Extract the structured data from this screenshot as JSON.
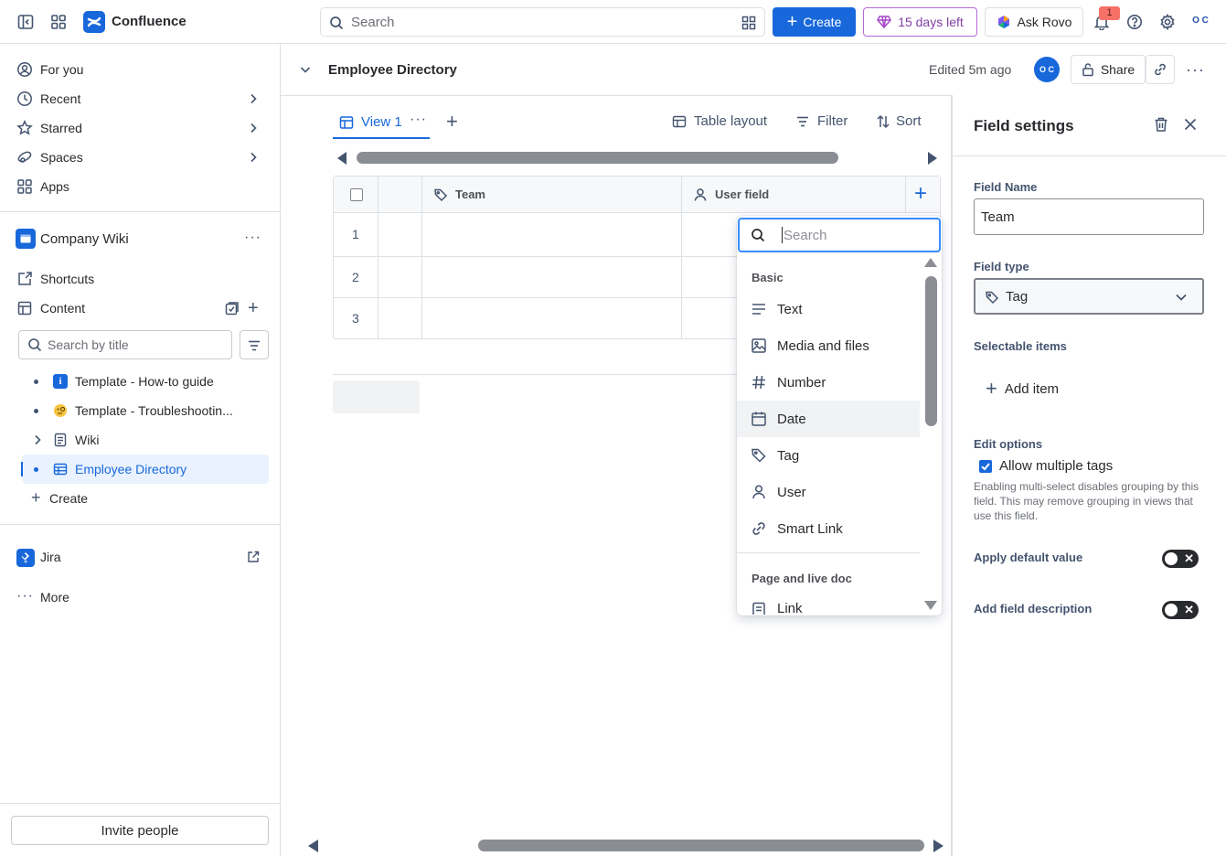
{
  "topbar": {
    "app_name": "Confluence",
    "search_placeholder": "Search",
    "create_label": "Create",
    "trial_label": "15 days left",
    "rovo_label": "Ask Rovo",
    "notification_count": "1",
    "avatar_initials": "O C",
    "brand_color": "#1868db"
  },
  "sidebar": {
    "nav": [
      {
        "label": "For you",
        "icon": "user-circle-icon"
      },
      {
        "label": "Recent",
        "icon": "clock-icon"
      },
      {
        "label": "Starred",
        "icon": "star-icon"
      },
      {
        "label": "Spaces",
        "icon": "spaces-icon"
      },
      {
        "label": "Apps",
        "icon": "apps-icon"
      }
    ],
    "space_name": "Company Wiki",
    "shortcuts_label": "Shortcuts",
    "content_label": "Content",
    "search_placeholder": "Search by title",
    "tree": [
      {
        "label": "Template - How-to guide",
        "icon": "info-icon"
      },
      {
        "label": "Template - Troubleshootin...",
        "icon": "emoji-icon"
      },
      {
        "label": "Wiki",
        "icon": "page-icon"
      },
      {
        "label": "Employee Directory",
        "icon": "database-icon",
        "selected": true
      }
    ],
    "create_label": "Create",
    "jira_label": "Jira",
    "more_label": "More",
    "invite_label": "Invite people"
  },
  "page": {
    "title": "Employee Directory",
    "edited": "Edited 5m ago",
    "owner_initials": "O C",
    "share_label": "Share"
  },
  "database": {
    "view_tab": "View 1",
    "layout_label": "Table layout",
    "filter_label": "Filter",
    "sort_label": "Sort",
    "columns": [
      "Team",
      "User field"
    ],
    "rows": [
      "1",
      "2",
      "3"
    ]
  },
  "type_menu": {
    "search_placeholder": "Search",
    "section_basic": "Basic",
    "items": [
      {
        "label": "Text",
        "icon": "text-lines-icon"
      },
      {
        "label": "Media and files",
        "icon": "image-icon"
      },
      {
        "label": "Number",
        "icon": "hash-icon"
      },
      {
        "label": "Date",
        "icon": "calendar-icon",
        "hovered": true
      },
      {
        "label": "Tag",
        "icon": "tag-icon"
      },
      {
        "label": "User",
        "icon": "person-icon"
      },
      {
        "label": "Smart Link",
        "icon": "link-icon"
      }
    ],
    "section_page": "Page and live doc",
    "page_items": [
      {
        "label": "Link",
        "icon": "page-icon"
      }
    ]
  },
  "field_settings": {
    "title": "Field settings",
    "name_label": "Field Name",
    "name_value": "Team",
    "type_label": "Field type",
    "type_value": "Tag",
    "selectable_label": "Selectable items",
    "add_item_label": "Add item",
    "edit_options_label": "Edit options",
    "multi_tags_label": "Allow multiple tags",
    "multi_tags_checked": true,
    "multi_help": "Enabling multi-select disables grouping by this field. This may remove grouping in views that use this field.",
    "default_value_label": "Apply default value",
    "default_value_on": false,
    "description_label": "Add field description",
    "description_on": false
  }
}
